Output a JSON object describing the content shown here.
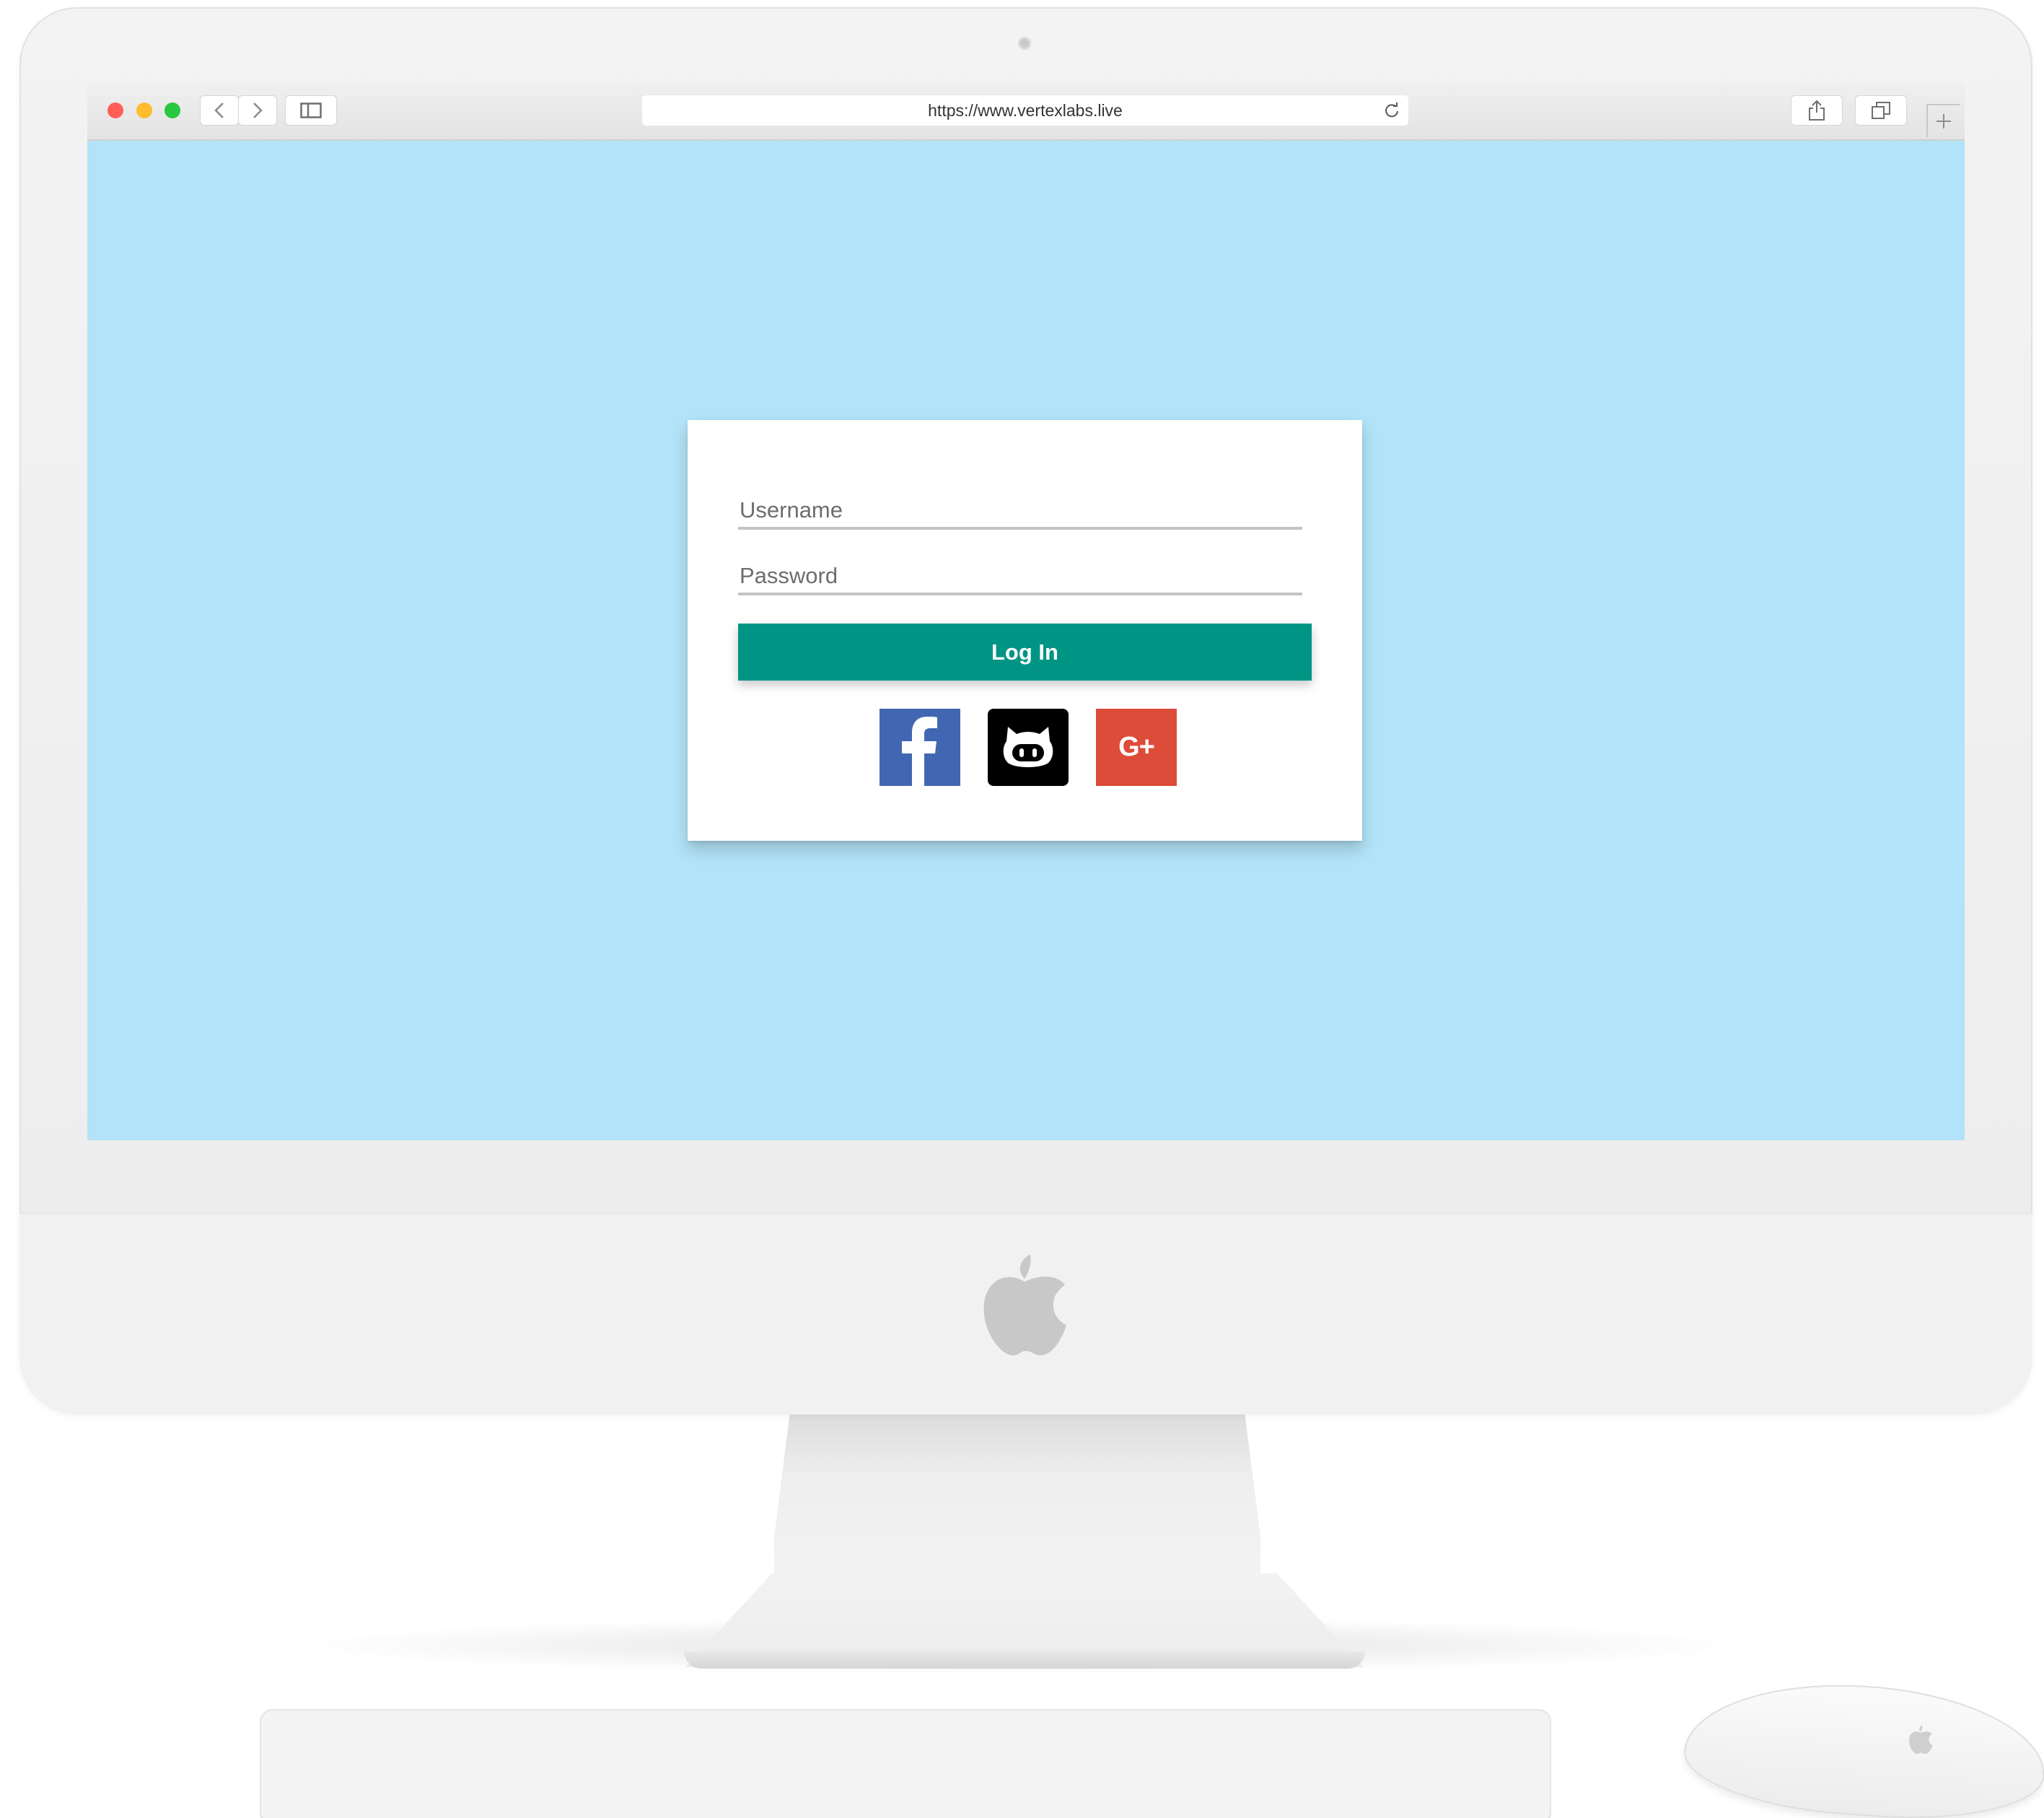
{
  "browser": {
    "url": "https://www.vertexlabs.live"
  },
  "login": {
    "username_placeholder": "Username",
    "password_placeholder": "Password",
    "login_button_label": "Log In",
    "social_buttons": [
      {
        "icon": "facebook-icon",
        "label": "f",
        "color": "#4267b2"
      },
      {
        "icon": "github-icon",
        "color": "#000000"
      },
      {
        "icon": "google-plus-icon",
        "label": "G+",
        "color": "#dd4b39"
      }
    ]
  },
  "colors": {
    "page_background": "#b2e3f8",
    "accent": "#009485",
    "traffic_close": "#ff5f57",
    "traffic_minimize": "#febc2e",
    "traffic_maximize": "#28c840"
  }
}
